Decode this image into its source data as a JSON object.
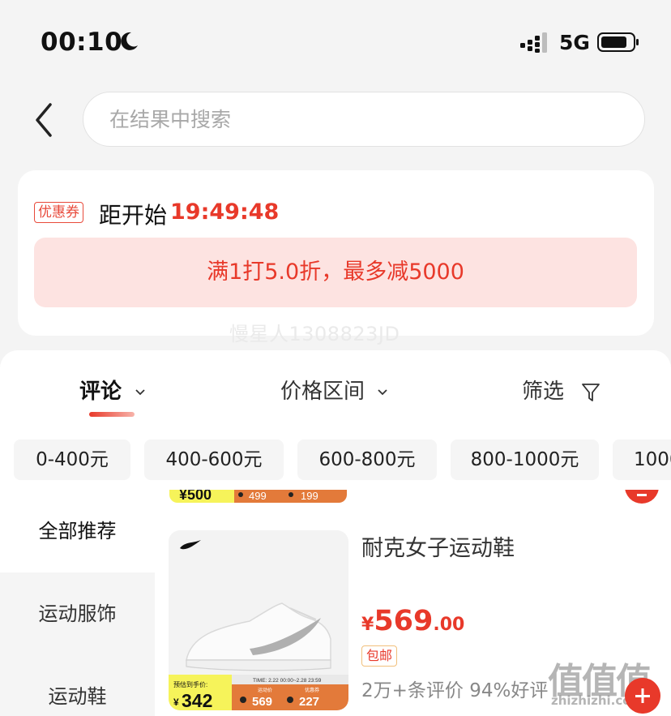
{
  "status_bar": {
    "time": "00:10",
    "network": "5G"
  },
  "search": {
    "placeholder": "在结果中搜索"
  },
  "coupon": {
    "tag": "优惠券",
    "countdown_label": "距开始",
    "countdown_time": "19:49:48",
    "discount_text": "满1打5.0折，最多减5000",
    "username_watermark": "慢星人1308823JD"
  },
  "sort_tabs": [
    {
      "label": "评论"
    },
    {
      "label": "价格区间"
    },
    {
      "label": "筛选"
    }
  ],
  "price_ranges": [
    "0-400元",
    "400-600元",
    "600-800元",
    "800-1000元",
    "1000"
  ],
  "categories": [
    "全部推荐",
    "运动服饰",
    "运动鞋"
  ],
  "product": {
    "title": "耐克女子运动鞋",
    "price_symbol": "¥",
    "price_int": "569",
    "price_dec": ".00",
    "shipping_badge": "包邮",
    "reviews": "2万+条评价  94%好评",
    "promo_banner": {
      "label": "预估到手价:",
      "price": "342",
      "time": "TIME: 2.22 00:00~2.28 23:59",
      "tag1": "运动价",
      "value1": "569",
      "tag2": "优惠券",
      "value2": "227"
    }
  },
  "prev_product_banner": {
    "price": "500",
    "value1": "499",
    "value2": "199"
  },
  "site_watermark": {
    "main": "值值值",
    "small": "zhizhizhi.com"
  },
  "colors": {
    "accent": "#e8392a",
    "discount_bg": "#fde3e1",
    "page_bg": "#f4f4f4"
  }
}
